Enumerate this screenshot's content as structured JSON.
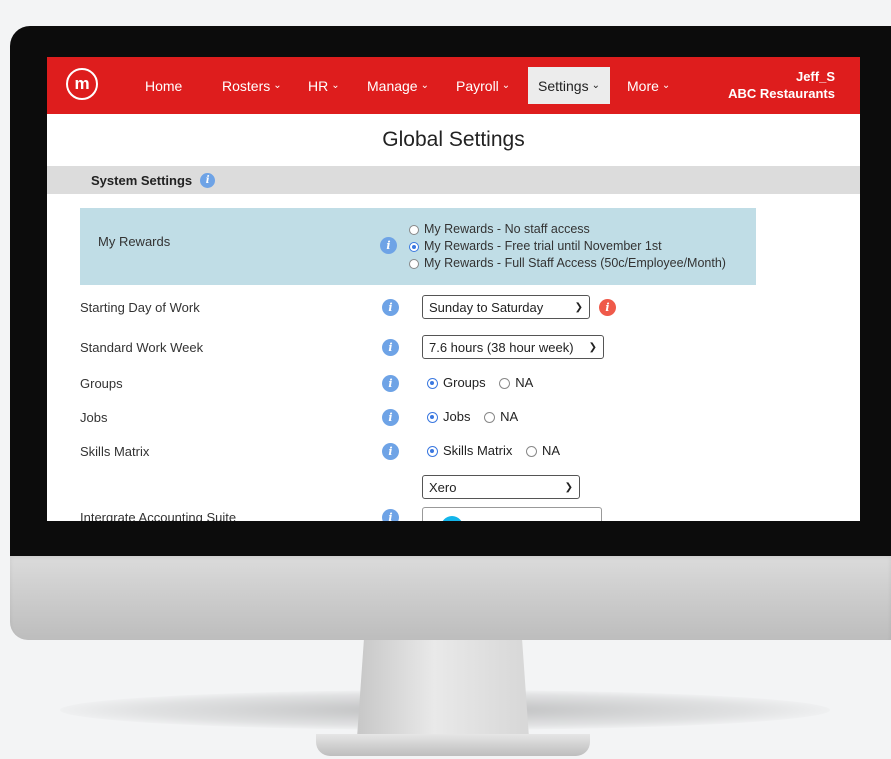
{
  "navbar": {
    "logo_glyph": "m",
    "items": [
      {
        "label": "Home",
        "has_dropdown": false
      },
      {
        "label": "Rosters",
        "has_dropdown": true
      },
      {
        "label": "HR",
        "has_dropdown": true
      },
      {
        "label": "Manage",
        "has_dropdown": true
      },
      {
        "label": "Payroll",
        "has_dropdown": true
      },
      {
        "label": "Settings",
        "has_dropdown": true,
        "active": true
      },
      {
        "label": "More",
        "has_dropdown": true
      }
    ],
    "user": "Jeff_S",
    "company": "ABC Restaurants",
    "colors": {
      "brand": "#de1d1d",
      "active_tab_bg": "#ececec"
    }
  },
  "page": {
    "title": "Global Settings"
  },
  "section": {
    "title": "System Settings"
  },
  "my_rewards": {
    "label": "My Rewards",
    "options": [
      {
        "label": "My Rewards - No staff access",
        "checked": false
      },
      {
        "label": "My Rewards - Free trial until November 1st",
        "checked": true
      },
      {
        "label": "My Rewards - Full Staff Access (50c/Employee/Month)",
        "checked": false
      }
    ],
    "highlight_color": "#c0dde6"
  },
  "starting_day": {
    "label": "Starting Day of Work",
    "value": "Sunday to Saturday"
  },
  "work_week": {
    "label": "Standard Work Week",
    "value": "7.6 hours (38 hour week)"
  },
  "groups": {
    "label": "Groups",
    "options": [
      {
        "label": "Groups",
        "checked": true
      },
      {
        "label": "NA",
        "checked": false
      }
    ]
  },
  "jobs": {
    "label": "Jobs",
    "options": [
      {
        "label": "Jobs",
        "checked": true
      },
      {
        "label": "NA",
        "checked": false
      }
    ]
  },
  "skills": {
    "label": "Skills Matrix",
    "options": [
      {
        "label": "Skills Matrix",
        "checked": true
      },
      {
        "label": "NA",
        "checked": false
      }
    ]
  },
  "accounting": {
    "label": "Intergrate Accounting Suite",
    "value": "Xero"
  },
  "icons": {
    "info": "info-icon",
    "warning": "warning-info-icon",
    "chevron": "chevron-down-icon",
    "logo": "m-logo-icon"
  }
}
